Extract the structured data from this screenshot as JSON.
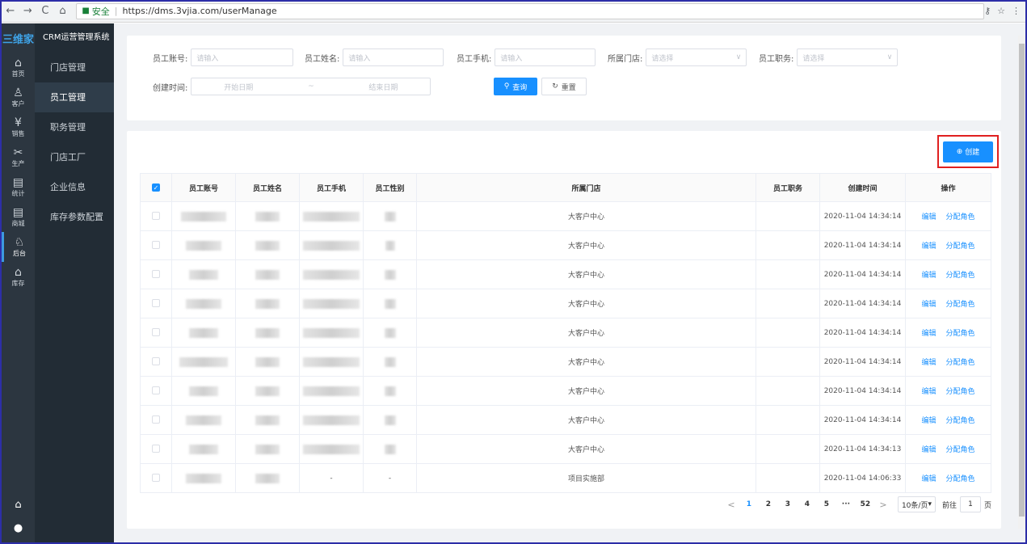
{
  "browser": {
    "back": "←",
    "forward": "→",
    "reload": "C",
    "home": "⌂",
    "secure_label": "安全",
    "url": "https://dms.3vjia.com/userManage",
    "key_icon": "⚷",
    "star_icon": "☆",
    "menu_icon": "⋮"
  },
  "rail": {
    "logo": "三维家",
    "items": [
      {
        "icon": "⌂",
        "label": "首页"
      },
      {
        "icon": "♙",
        "label": "客户"
      },
      {
        "icon": "¥",
        "label": "销售"
      },
      {
        "icon": "✂",
        "label": "生产"
      },
      {
        "icon": "▤",
        "label": "统计"
      },
      {
        "icon": "▤",
        "label": "商城"
      },
      {
        "icon": "♘",
        "label": "后台"
      },
      {
        "icon": "⌂",
        "label": "库存"
      }
    ],
    "bottom": [
      "⌂",
      "●"
    ]
  },
  "submenu": {
    "title": "CRM运营管理系统",
    "items": [
      "门店管理",
      "员工管理",
      "职务管理",
      "门店工厂",
      "企业信息",
      "库存参数配置"
    ]
  },
  "filters": {
    "account_label": "员工账号:",
    "account_placeholder": "请输入",
    "name_label": "员工姓名:",
    "name_placeholder": "请输入",
    "phone_label": "员工手机:",
    "phone_placeholder": "请输入",
    "store_label": "所属门店:",
    "store_placeholder": "请选择",
    "position_label": "员工职务:",
    "position_placeholder": "请选择",
    "created_label": "创建时间:",
    "start_placeholder": "开始日期",
    "range_sep": "~",
    "end_placeholder": "结束日期",
    "search_label": "查询",
    "reset_label": "重置"
  },
  "create_label": "创建",
  "table": {
    "headers": [
      "员工账号",
      "员工姓名",
      "员工手机",
      "员工性别",
      "所属门店",
      "员工职务",
      "创建时间",
      "操作"
    ],
    "edit_label": "编辑",
    "assign_label": "分配角色",
    "rows": [
      {
        "store": "大客户中心",
        "created": "2020-11-04 14:34:14"
      },
      {
        "store": "大客户中心",
        "created": "2020-11-04 14:34:14"
      },
      {
        "store": "大客户中心",
        "created": "2020-11-04 14:34:14"
      },
      {
        "store": "大客户中心",
        "created": "2020-11-04 14:34:14"
      },
      {
        "store": "大客户中心",
        "created": "2020-11-04 14:34:14"
      },
      {
        "store": "大客户中心",
        "created": "2020-11-04 14:34:14"
      },
      {
        "store": "大客户中心",
        "created": "2020-11-04 14:34:14"
      },
      {
        "store": "大客户中心",
        "created": "2020-11-04 14:34:14"
      },
      {
        "store": "大客户中心",
        "created": "2020-11-04 14:34:13"
      },
      {
        "store": "项目实施部",
        "created": "2020-11-04 14:06:33",
        "phone": "-",
        "gender": "-"
      }
    ]
  },
  "pagination": {
    "prev": "<",
    "next": ">",
    "pages": [
      "1",
      "2",
      "3",
      "4",
      "5",
      "···",
      "52"
    ],
    "page_size": "10条/页",
    "goto_label": "前往",
    "goto_value": "1",
    "page_unit": "页"
  }
}
